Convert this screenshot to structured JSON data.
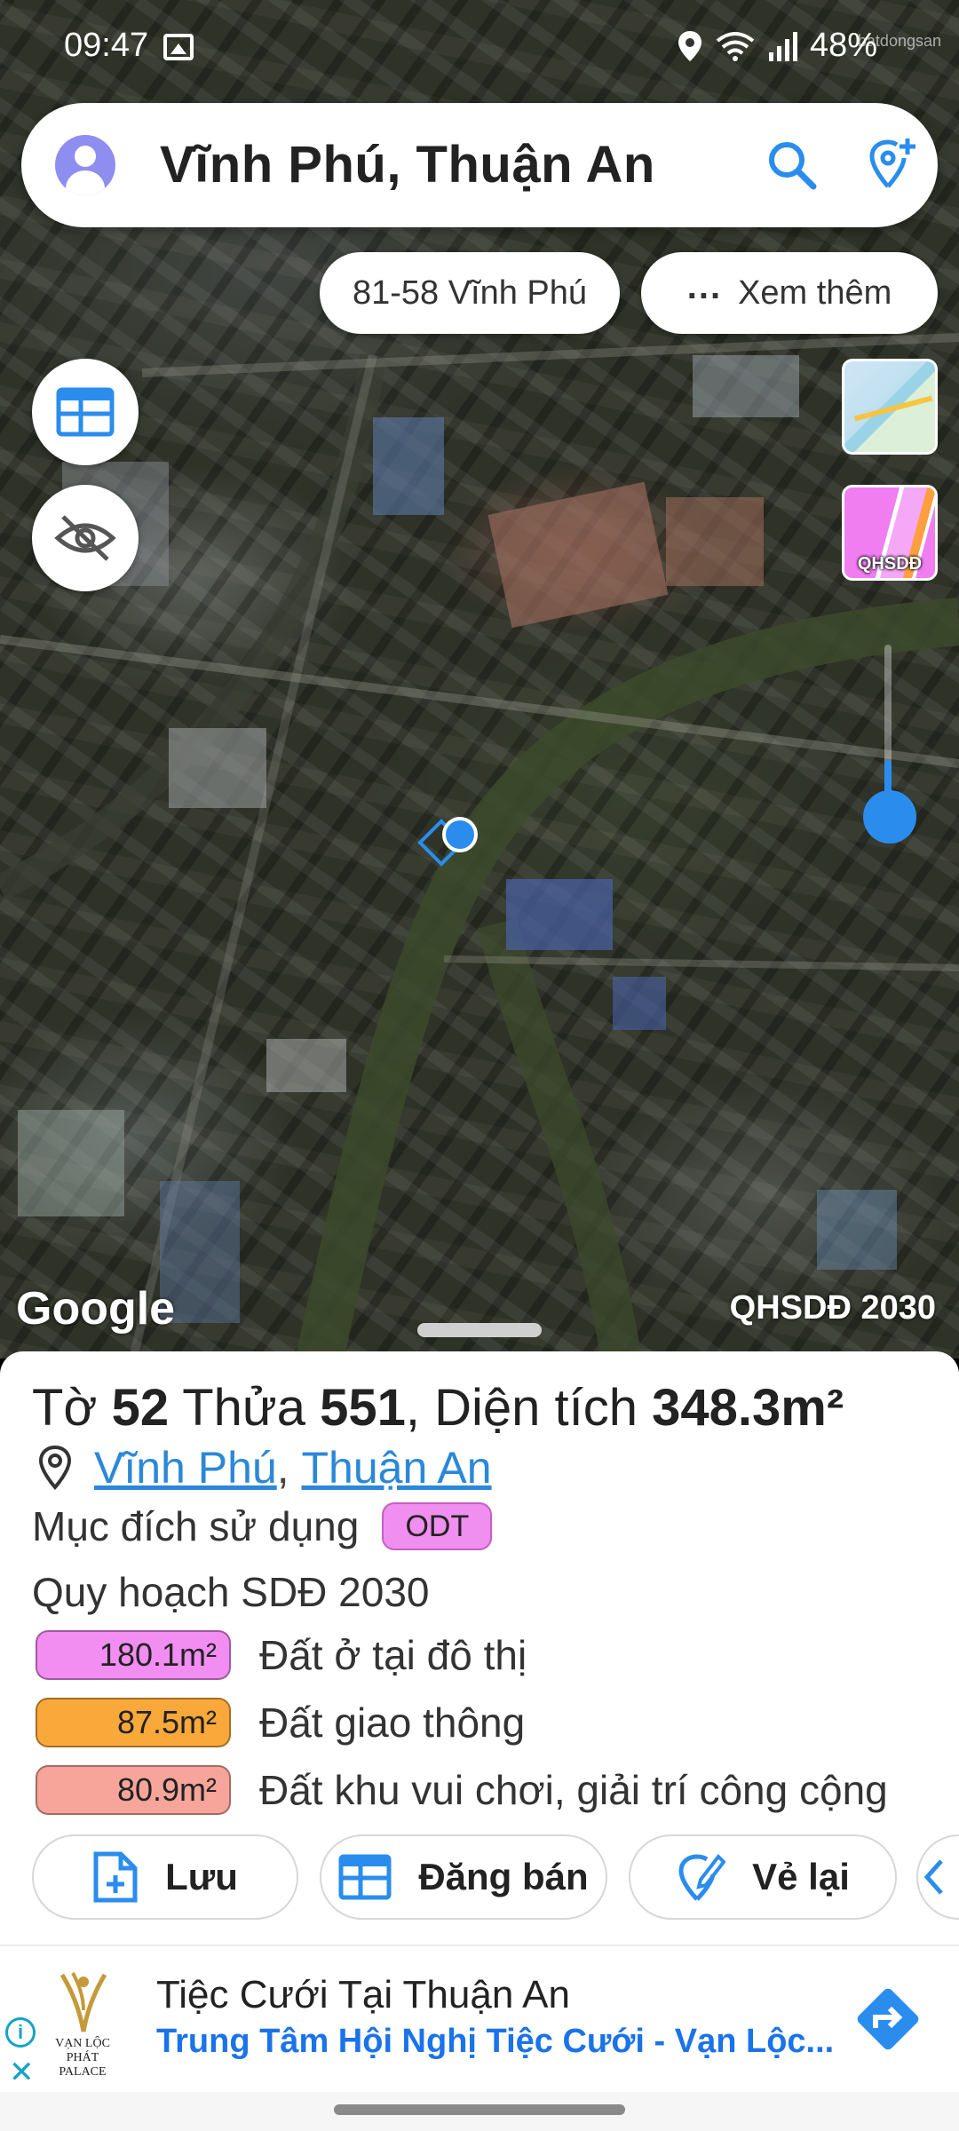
{
  "status_bar": {
    "time": "09:47",
    "battery": "48%",
    "watermark": "batdongsan"
  },
  "search": {
    "title": "Vĩnh Phú, Thuận An"
  },
  "chips": {
    "address": "81-58 Vĩnh Phú",
    "more_dots": "...",
    "more_label": "Xem thêm"
  },
  "map": {
    "thumb_label": "QHSDĐ",
    "google": "Google",
    "plan_label": "QHSDĐ 2030",
    "zoom_level": 0.35
  },
  "parcel": {
    "to_label": "Tờ",
    "to_value": "52",
    "thua_label": "Thửa",
    "thua_value": "551",
    "area_label": "Diện tích",
    "area_value": "348.3m²",
    "ward": "Vĩnh Phú",
    "district": "Thuận An",
    "purpose_label": "Mục đích sử dụng",
    "purpose_code": "ODT",
    "plan_title": "Quy hoạch SDĐ 2030",
    "zones": [
      {
        "area": "180.1m²",
        "label": "Đất ở tại đô thị",
        "color": "#f28df2"
      },
      {
        "area": "87.5m²",
        "label": "Đất giao thông",
        "color": "#f9a83a"
      },
      {
        "area": "80.9m²",
        "label": "Đất khu vui chơi, giải trí công cộng",
        "color": "#f7a59a"
      }
    ]
  },
  "actions": {
    "save": "Lưu",
    "sell": "Đăng bán",
    "redraw": "Vẻ lại"
  },
  "ad": {
    "title": "Tiệc Cưới Tại Thuận An",
    "subtitle": "Trung Tâm Hội Nghị Tiệc Cưới - Vạn Lộc...",
    "logo_text_1": "VẠN LỘC PHÁT",
    "logo_text_2": "PALACE",
    "info": "i",
    "close": "✕"
  },
  "colors": {
    "accent": "#2a8dee",
    "link": "#2b88d8",
    "ad_link": "#1a73e8"
  }
}
